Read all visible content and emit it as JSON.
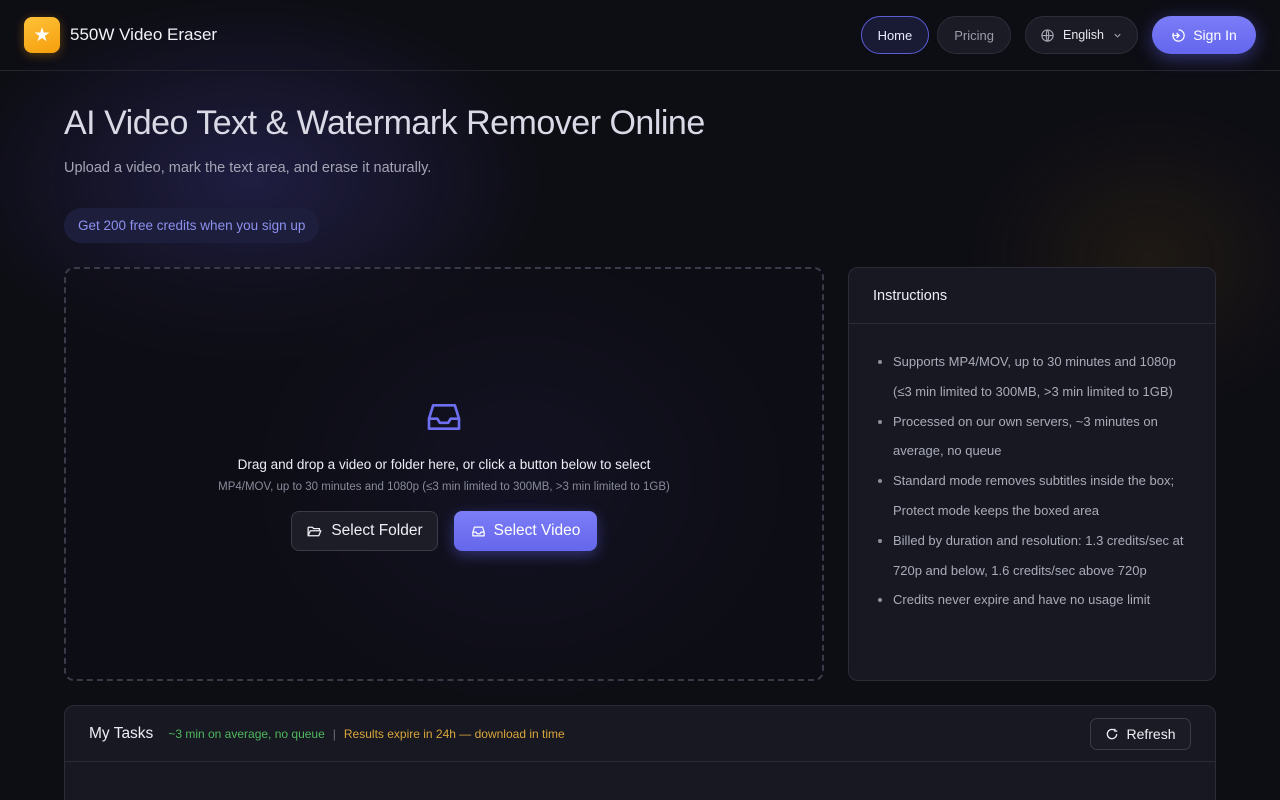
{
  "header": {
    "brand_name": "550W Video Eraser",
    "nav": {
      "home": "Home",
      "pricing": "Pricing",
      "language": "English",
      "sign_in": "Sign In"
    }
  },
  "hero": {
    "title": "AI Video Text & Watermark Remover Online",
    "subtitle": "Upload a video, mark the text area, and erase it naturally.",
    "promo": "Get 200 free credits when you sign up"
  },
  "upload": {
    "main_text": "Drag and drop a video or folder here, or click a button below to select",
    "hint": "MP4/MOV, up to 30 minutes and 1080p (≤3 min limited to 300MB, >3 min limited to 1GB)",
    "select_folder": "Select Folder",
    "select_video": "Select Video"
  },
  "instructions": {
    "title": "Instructions",
    "items": [
      "Supports MP4/MOV, up to 30 minutes and 1080p (≤3 min limited to 300MB, >3 min limited to 1GB)",
      "Processed on our own servers, ~3 minutes on average, no queue",
      "Standard mode removes subtitles inside the box; Protect mode keeps the boxed area",
      "Billed by duration and resolution: 1.3 credits/sec at 720p and below, 1.6 credits/sec above 720p",
      "Credits never expire and have no usage limit"
    ]
  },
  "tasks": {
    "title": "My Tasks",
    "note_speed": "~3 min on average, no queue",
    "separator": "|",
    "note_expire": "Results expire in 24h — download in time",
    "refresh": "Refresh"
  },
  "colors": {
    "accent": "#6366f1",
    "logo": "#f59e0b",
    "success": "#4fb85e",
    "warning": "#d8a53a",
    "background": "#0d0d14"
  },
  "icons": {
    "logo": "star-icon",
    "language": "globe-icon",
    "sign_in": "login-icon",
    "drop": "inbox-icon",
    "folder": "folder-open-icon",
    "video": "inbox-icon",
    "refresh": "refresh-icon"
  }
}
